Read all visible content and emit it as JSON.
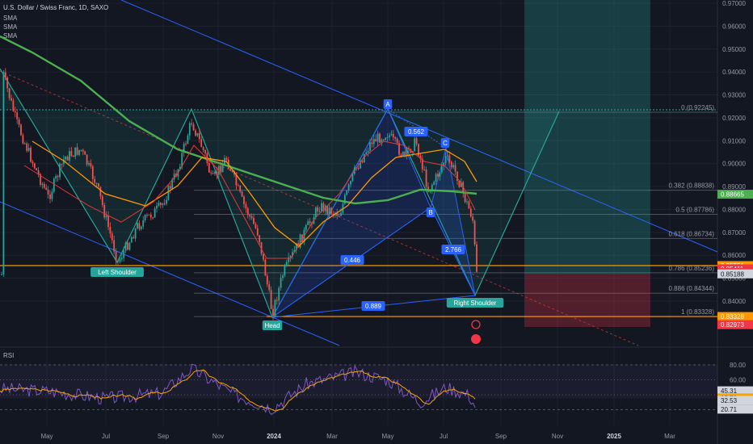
{
  "header": {
    "symbol_title": "U.S. Dollar / Swiss Franc, 1D, SAXO",
    "indicators": [
      "SMA",
      "SMA",
      "SMA"
    ]
  },
  "rsi_title": "RSI",
  "colors": {
    "bg": "#131722",
    "grid": "#1e222d",
    "sma_green": "#4caf50",
    "sma_orange": "#ff9800",
    "sma_red": "#e53935",
    "pattern_blue": "#2962ff",
    "pattern_green": "#26a69a",
    "up": "#26a69a",
    "down": "#ef5350",
    "fib": "#787b86",
    "rsi_line": "#7e57c2",
    "rsi_ma": "#f7a600"
  },
  "chart_data": {
    "type": "line",
    "subtype": "candlestick-with-harmonic-pattern",
    "title": "U.S. Dollar / Swiss Franc, 1D, SAXO",
    "x_ticks": [
      "May",
      "Jul",
      "Sep",
      "Nov",
      "2024",
      "Mar",
      "May",
      "Jul",
      "Sep",
      "Nov",
      "2025",
      "Mar"
    ],
    "x_ticks_bold": [
      "2024",
      "2025"
    ],
    "y_ticks": [
      0.97,
      0.96,
      0.95,
      0.94,
      0.93,
      0.92,
      0.91,
      0.9,
      0.89,
      0.88,
      0.87,
      0.86,
      0.85,
      0.84
    ],
    "ylim": [
      0.827,
      0.97
    ],
    "close_approx": {
      "x": [
        "May",
        "Jul",
        "Sep",
        "Nov",
        "2024",
        "Mar",
        "May",
        "Jul",
        "Sep"
      ],
      "values": [
        0.925,
        0.903,
        0.875,
        0.918,
        0.904,
        0.872,
        0.842,
        0.864,
        0.889,
        0.909,
        0.904,
        0.88,
        0.897,
        0.905,
        0.868,
        0.854
      ]
    },
    "harmonic_points": [
      {
        "label": "Left Shoulder",
        "price": 0.8555
      },
      {
        "label": "Head",
        "price": 0.8335
      },
      {
        "label": "A",
        "price": 0.9225
      },
      {
        "label": "B",
        "price": 0.879
      },
      {
        "label": "C",
        "price": 0.906
      },
      {
        "label": "Right Shoulder",
        "price": 0.8434
      }
    ],
    "pattern_ratios": [
      "0.562",
      "0.446",
      "2.766",
      "0.889"
    ],
    "fib_levels": [
      {
        "label": "0 (0.92245)",
        "price": 0.92245
      },
      {
        "label": "0.382 (0.88838)",
        "price": 0.88838
      },
      {
        "label": "0.5 (0.87786)",
        "price": 0.87786
      },
      {
        "label": "0.618 (0.86734)",
        "price": 0.86734
      },
      {
        "label": "0.786 (0.85236)",
        "price": 0.85236
      },
      {
        "label": "0.886 (0.84344)",
        "price": 0.84344
      },
      {
        "label": "1 (0.83328)",
        "price": 0.83328
      }
    ],
    "price_badges": [
      {
        "text": "0.88665",
        "price": 0.88665,
        "color": "#4caf50"
      },
      {
        "text": "0.85551",
        "price": 0.85551,
        "color": "#ff9800"
      },
      {
        "text": "0.85411",
        "price": 0.85411,
        "color": "#f23645"
      },
      {
        "text": "04:14:36",
        "price": 0.8525,
        "color": "#f23645"
      },
      {
        "text": "0.85188",
        "price": 0.85188,
        "color": "#d1d4dc"
      },
      {
        "text": "0.83328",
        "price": 0.83328,
        "color": "#ff9800"
      },
      {
        "text": "0.82973",
        "price": 0.82973,
        "color": "#f23645"
      }
    ],
    "rsi": {
      "y_ticks": [
        80.0,
        60.0
      ],
      "ylim": [
        15,
        85
      ],
      "badges": [
        {
          "text": "45.31",
          "value": 45.31,
          "color": "#d1d4dc"
        },
        {
          "text": "35.79",
          "value": 35.79,
          "color": "#f7a600"
        },
        {
          "text": "32.53",
          "value": 32.53,
          "color": "#d1d4dc"
        },
        {
          "text": "20.71",
          "value": 20.71,
          "color": "#d1d4dc"
        }
      ]
    }
  }
}
